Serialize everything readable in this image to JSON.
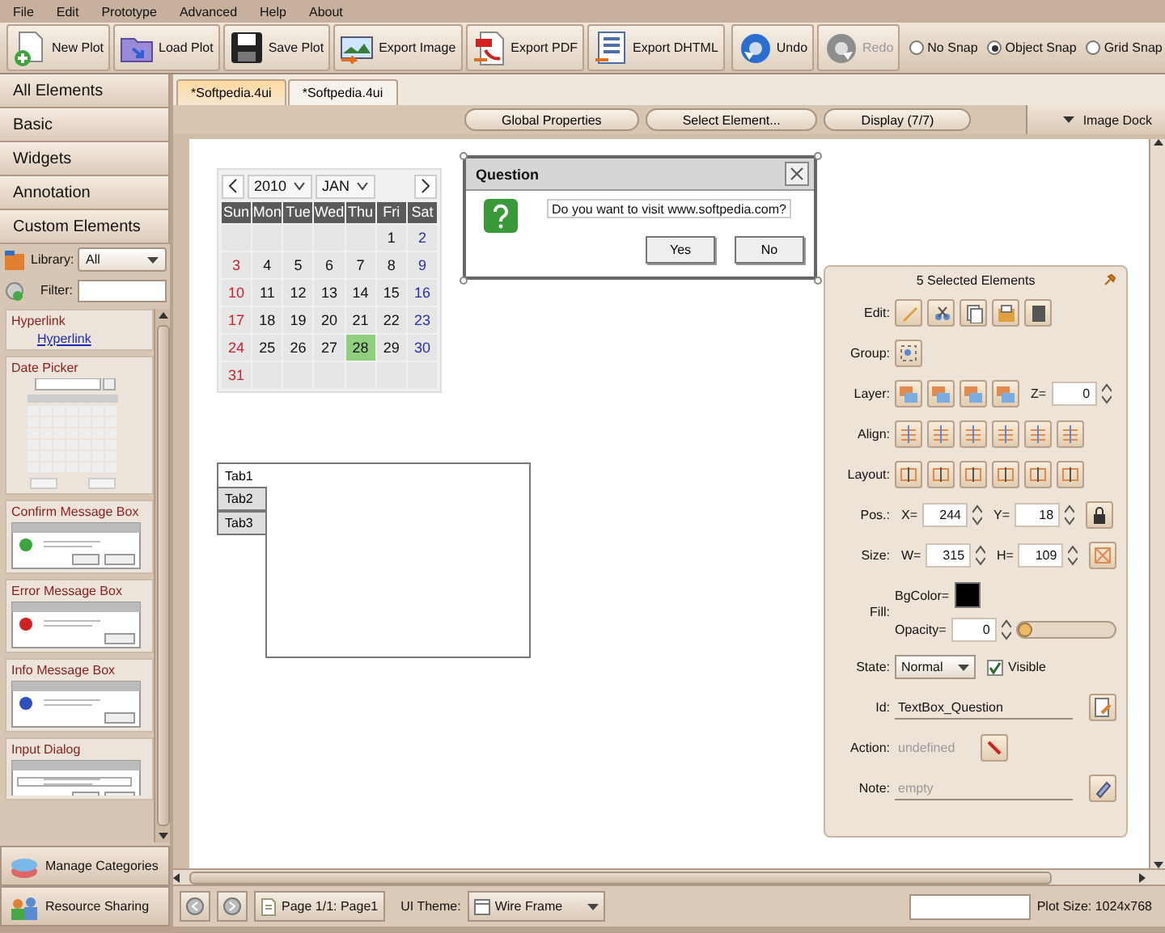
{
  "menu": [
    "File",
    "Edit",
    "Prototype",
    "Advanced",
    "Help",
    "About"
  ],
  "toolbar": {
    "buttons": [
      {
        "kind": "new",
        "label": "New Plot",
        "disabled": false
      },
      {
        "kind": "load",
        "label": "Load Plot",
        "disabled": false
      },
      {
        "kind": "save",
        "label": "Save Plot",
        "disabled": false
      },
      {
        "kind": "image",
        "label": "Export Image",
        "disabled": false
      },
      {
        "kind": "pdf",
        "label": "Export PDF",
        "disabled": false
      },
      {
        "kind": "dhtml",
        "label": "Export DHTML",
        "disabled": false
      },
      {
        "kind": "undo",
        "label": "Undo",
        "disabled": false
      },
      {
        "kind": "redo",
        "label": "Redo",
        "disabled": true
      }
    ],
    "snap": [
      {
        "label": "No Snap",
        "selected": false
      },
      {
        "label": "Object Snap",
        "selected": true
      },
      {
        "label": "Grid Snap",
        "selected": false
      }
    ]
  },
  "sidebar": {
    "categories": [
      "All Elements",
      "Basic",
      "Widgets",
      "Annotation",
      "Custom Elements"
    ],
    "library_label": "Library:",
    "library_value": "All",
    "filter_label": "Filter:",
    "elements": [
      {
        "kind": "hyperlink",
        "title": "Hyperlink",
        "link": "Hyperlink"
      },
      {
        "kind": "datepicker",
        "title": "Date Picker"
      },
      {
        "kind": "confirm",
        "title": "Confirm Message Box"
      },
      {
        "kind": "error",
        "title": "Error Message Box"
      },
      {
        "kind": "info",
        "title": "Info Message Box"
      },
      {
        "kind": "input",
        "title": "Input Dialog"
      }
    ],
    "footer": [
      {
        "kind": "categories",
        "label": "Manage Categories"
      },
      {
        "kind": "sharing",
        "label": "Resource Sharing"
      }
    ]
  },
  "document_tabs": [
    {
      "label": "*Softpedia.4ui",
      "selected": true
    },
    {
      "label": "*Softpedia.4ui",
      "selected": false
    }
  ],
  "canvas_toolbar": {
    "buttons": [
      "Global Properties",
      "Select Element...",
      "Display (7/7)"
    ],
    "image_dock": "Image Dock"
  },
  "calendar": {
    "year": "2010",
    "month": "JAN",
    "weekdays": [
      "Sun",
      "Mon",
      "Tue",
      "Wed",
      "Thu",
      "Fri",
      "Sat"
    ],
    "weeks": [
      {
        "kind": "end",
        "days": [
          {
            "day": "1",
            "selected": false
          },
          {
            "day": "2",
            "selected": false
          }
        ]
      },
      {
        "kind": "start",
        "days": [
          {
            "day": "3",
            "selected": false
          },
          {
            "day": "4",
            "selected": false
          },
          {
            "day": "5",
            "selected": false
          },
          {
            "day": "6",
            "selected": false
          },
          {
            "day": "7",
            "selected": false
          },
          {
            "day": "8",
            "selected": false
          },
          {
            "day": "9",
            "selected": false
          }
        ]
      },
      {
        "kind": "start",
        "days": [
          {
            "day": "10",
            "selected": false
          },
          {
            "day": "11",
            "selected": false
          },
          {
            "day": "12",
            "selected": false
          },
          {
            "day": "13",
            "selected": false
          },
          {
            "day": "14",
            "selected": false
          },
          {
            "day": "15",
            "selected": false
          },
          {
            "day": "16",
            "selected": false
          }
        ]
      },
      {
        "kind": "start",
        "days": [
          {
            "day": "17",
            "selected": false
          },
          {
            "day": "18",
            "selected": false
          },
          {
            "day": "19",
            "selected": false
          },
          {
            "day": "20",
            "selected": false
          },
          {
            "day": "21",
            "selected": false
          },
          {
            "day": "22",
            "selected": false
          },
          {
            "day": "23",
            "selected": false
          }
        ]
      },
      {
        "kind": "start",
        "days": [
          {
            "day": "24",
            "selected": false
          },
          {
            "day": "25",
            "selected": false
          },
          {
            "day": "26",
            "selected": false
          },
          {
            "day": "27",
            "selected": false
          },
          {
            "day": "28",
            "selected": true
          },
          {
            "day": "29",
            "selected": false
          },
          {
            "day": "30",
            "selected": false
          }
        ]
      },
      {
        "kind": "start",
        "days": [
          {
            "day": "31",
            "selected": false
          }
        ]
      }
    ]
  },
  "dialog": {
    "title": "Question",
    "message": "Do you want to visit www.softpedia.com?",
    "buttons": [
      "Yes",
      "No"
    ]
  },
  "tab_widget": {
    "tabs": [
      {
        "label": "Tab1",
        "selected": true
      },
      {
        "label": "Tab2",
        "selected": false
      },
      {
        "label": "Tab3",
        "selected": false
      }
    ]
  },
  "properties": {
    "title": "5 Selected Elements",
    "rows": [
      {
        "kind": "edit",
        "label": "Edit:"
      },
      {
        "kind": "group",
        "label": "Group:"
      },
      {
        "kind": "layer",
        "label": "Layer:",
        "z_label": "Z=",
        "z_value": "0"
      },
      {
        "kind": "align",
        "label": "Align:"
      },
      {
        "kind": "layout",
        "label": "Layout:"
      },
      {
        "kind": "pos",
        "label": "Pos.:",
        "a_label": "X=",
        "a_value": "244",
        "b_label": "Y=",
        "b_value": "18"
      },
      {
        "kind": "size",
        "label": "Size:",
        "a_label": "W=",
        "a_value": "315",
        "b_label": "H=",
        "b_value": "109"
      },
      {
        "kind": "fill",
        "label": "Fill:",
        "bgcolor_label": "BgColor=",
        "color": "#000000",
        "opacity_label": "Opacity=",
        "opacity_value": "0",
        "level": 0
      },
      {
        "kind": "state",
        "label": "State:",
        "value": "Normal",
        "visible_label": "Visible",
        "checked": true
      },
      {
        "kind": "id",
        "label": "Id:",
        "value": "TextBox_Question"
      },
      {
        "kind": "action",
        "label": "Action:",
        "placeholder": "undefined"
      },
      {
        "kind": "note",
        "label": "Note:",
        "placeholder": "empty"
      }
    ]
  },
  "status_bar": {
    "page": "Page 1/1: Page1",
    "theme_label": "UI Theme:",
    "theme_value": "Wire Frame",
    "plot_size": "Plot Size: 1024x768"
  }
}
